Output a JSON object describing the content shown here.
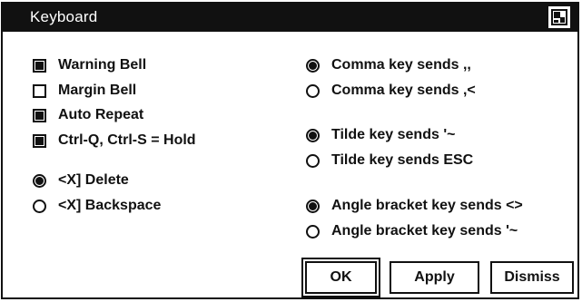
{
  "window": {
    "title": "Keyboard",
    "icon": "window-menu-icon"
  },
  "left_options": {
    "checkboxes": [
      {
        "label": "Warning Bell",
        "checked": true
      },
      {
        "label": "Margin Bell",
        "checked": false
      },
      {
        "label": "Auto Repeat",
        "checked": true
      },
      {
        "label": "Ctrl-Q, Ctrl-S = Hold",
        "checked": true
      }
    ],
    "delete_key": [
      {
        "label": "<X] Delete",
        "selected": true
      },
      {
        "label": "<X] Backspace",
        "selected": false
      }
    ]
  },
  "right_options": {
    "comma_key": [
      {
        "label": "Comma key sends ,,",
        "selected": true
      },
      {
        "label": "Comma key sends ,<",
        "selected": false
      }
    ],
    "tilde_key": [
      {
        "label": "Tilde key sends '~",
        "selected": true
      },
      {
        "label": "Tilde key sends ESC",
        "selected": false
      }
    ],
    "angle_bracket_key": [
      {
        "label": "Angle bracket key sends <>",
        "selected": true
      },
      {
        "label": "Angle bracket key sends '~",
        "selected": false
      }
    ]
  },
  "buttons": {
    "ok": "OK",
    "apply": "Apply",
    "dismiss": "Dismiss"
  }
}
